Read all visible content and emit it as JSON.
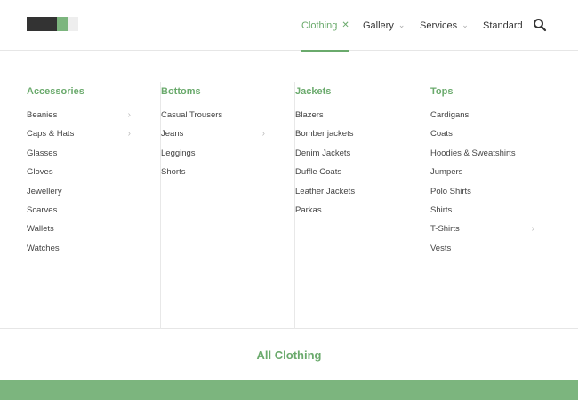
{
  "nav": {
    "items": [
      {
        "label": "Clothing",
        "active": true
      },
      {
        "label": "Gallery"
      },
      {
        "label": "Services"
      },
      {
        "label": "Standard"
      }
    ],
    "chevron": "⌄",
    "close": "✕"
  },
  "menu": {
    "columns": [
      {
        "title": "Accessories",
        "items": [
          {
            "label": "Beanies",
            "submenu": true
          },
          {
            "label": "Caps & Hats",
            "submenu": true
          },
          {
            "label": "Glasses"
          },
          {
            "label": "Gloves"
          },
          {
            "label": "Jewellery"
          },
          {
            "label": "Scarves"
          },
          {
            "label": "Wallets"
          },
          {
            "label": "Watches"
          }
        ]
      },
      {
        "title": "Bottoms",
        "items": [
          {
            "label": "Casual Trousers"
          },
          {
            "label": "Jeans",
            "submenu": true
          },
          {
            "label": "Leggings"
          },
          {
            "label": "Shorts"
          }
        ]
      },
      {
        "title": "Jackets",
        "items": [
          {
            "label": "Blazers"
          },
          {
            "label": "Bomber jackets"
          },
          {
            "label": "Denim Jackets"
          },
          {
            "label": "Duffle Coats"
          },
          {
            "label": "Leather Jackets"
          },
          {
            "label": "Parkas"
          }
        ]
      },
      {
        "title": "Tops",
        "items": [
          {
            "label": "Cardigans"
          },
          {
            "label": "Coats"
          },
          {
            "label": "Hoodies & Sweatshirts"
          },
          {
            "label": "Jumpers"
          },
          {
            "label": "Polo Shirts"
          },
          {
            "label": "Shirts"
          },
          {
            "label": "T-Shirts",
            "submenu": true
          },
          {
            "label": "Vests"
          }
        ]
      }
    ],
    "all_label": "All Clothing",
    "submenu_chevron": "›"
  },
  "colors": {
    "accent": "#6aaa6c",
    "band": "#7cb57e",
    "logo_dark": "#333333"
  },
  "icons": {
    "search": "search-icon",
    "submenu": "chevron-right-icon"
  }
}
